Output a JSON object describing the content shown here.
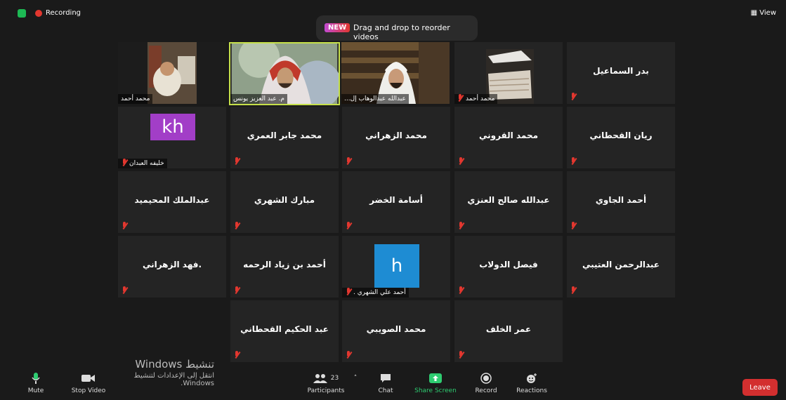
{
  "topbar": {
    "recording_label": "Recording",
    "view_label": "View"
  },
  "toast": {
    "badge": "NEW",
    "message": "Drag and drop to reorder videos"
  },
  "participants": {
    "video": [
      {
        "name": "محمد أحمد"
      },
      {
        "name": "م. عبد العزيز يونس"
      },
      {
        "name": "عبدالله عبدالوهاب إل..."
      },
      {
        "name": "محمد أحمد"
      }
    ],
    "named_tiles": [
      "بدر السماعيل",
      "محمد جابر العمري",
      "محمد الزهراني",
      "محمد القروني",
      "ريان القحطاني",
      "عبدالملك المحيميد",
      "مبارك الشهري",
      "أسامة الخضر",
      "عبدالله صالح العنزي",
      "أحمد الجاوي",
      ".فهد الزهراني",
      "أحمد بن زياد الرحمه",
      "فيصل الدولاب",
      "عبدالرحمن العتيبي",
      "عبد الحكيم القحطاني",
      "محمد الصويبي",
      "عمر الخلف"
    ],
    "avatar_tiles": [
      {
        "initials": "kh",
        "name": "خليفه العبدان",
        "color": "#a23ec7"
      },
      {
        "initials": "h",
        "name": "أحمد علي الشهري .",
        "color": "#1e8cd3"
      }
    ]
  },
  "watermark": {
    "line1": "تنشيط Windows",
    "line2": "انتقل إلى الإعدادات لتنشيط Windows."
  },
  "toolbar": {
    "mute": "Mute",
    "stop_video": "Stop Video",
    "participants": "Participants",
    "participants_count": "23",
    "chat": "Chat",
    "share_screen": "Share Screen",
    "record": "Record",
    "reactions": "Reactions",
    "leave": "Leave"
  },
  "colors": {
    "share_green": "#2ecc71",
    "leave_red": "#d32f2f",
    "active_speaker": "#c6e04a"
  }
}
